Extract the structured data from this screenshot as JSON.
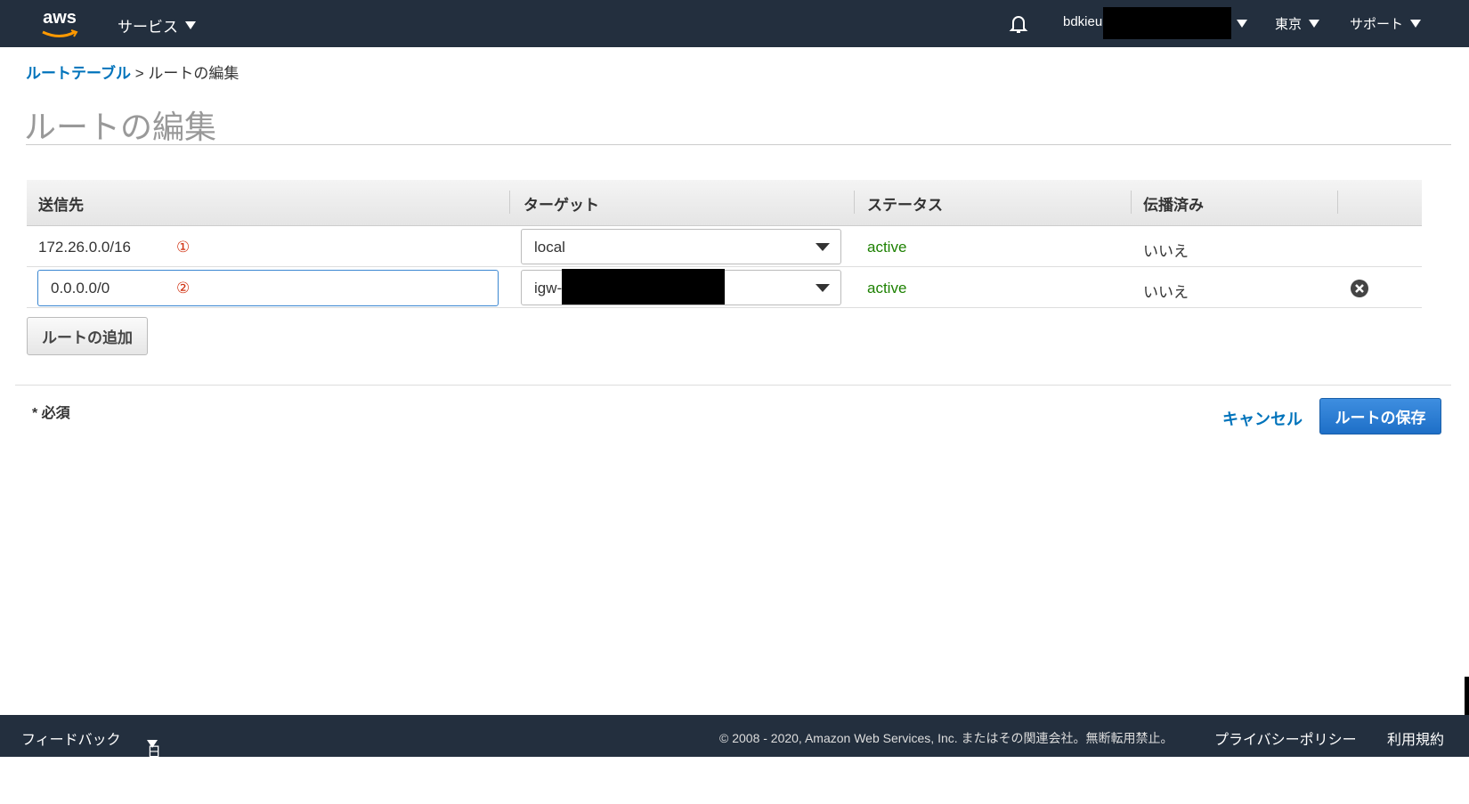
{
  "header": {
    "logo": "aws",
    "services": "サービス",
    "username": "bdkieu",
    "region": "東京",
    "support": "サポート"
  },
  "breadcrumb": {
    "parent": "ルートテーブル",
    "separator": ">",
    "current": "ルートの編集"
  },
  "page_title": "ルートの編集",
  "table": {
    "columns": [
      "送信先",
      "ターゲット",
      "ステータス",
      "伝播済み"
    ],
    "rows": [
      {
        "destination": "172.26.0.0/16",
        "marker": "①",
        "target": "local",
        "status": "active",
        "propagated": "いいえ"
      },
      {
        "destination": "0.0.0.0/0",
        "marker": "②",
        "target": "igw-",
        "status": "active",
        "propagated": "いいえ"
      }
    ]
  },
  "add_route": "ルートの追加",
  "required": "* 必須",
  "cancel": "キャンセル",
  "save": "ルートの保存",
  "footer": {
    "feedback": "フィードバック",
    "language": "日本語",
    "copyright": "© 2008 - 2020, Amazon Web Services, Inc. またはその関連会社。無断転用禁止。",
    "privacy": "プライバシーポリシー",
    "terms": "利用規約"
  }
}
